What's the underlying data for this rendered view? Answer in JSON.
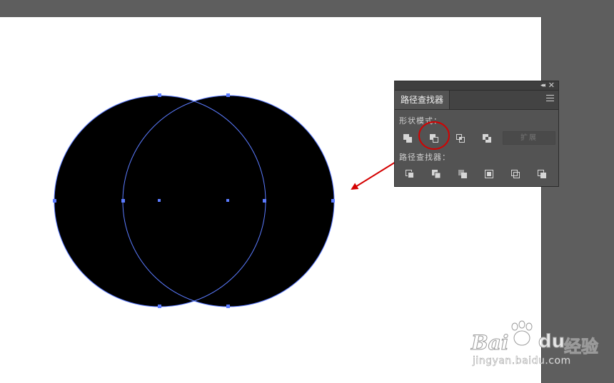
{
  "window": {
    "background": "#5e5e5e",
    "artboard_color": "#ffffff"
  },
  "artwork": {
    "fill_color": "#000000",
    "selection_color": "#5b7bff",
    "annotation_color": "#d40000",
    "shapes": [
      {
        "name": "left-circle",
        "type": "circle"
      },
      {
        "name": "right-circle",
        "type": "circle"
      }
    ]
  },
  "pathfinder_panel": {
    "collapse_glyph": "◂◂",
    "close_glyph": "✕",
    "tab_label": "路径查找器",
    "shape_modes_label": "形状模式：",
    "pathfinders_label": "路径查找器：",
    "expand_label": "扩展",
    "shape_mode_buttons": [
      {
        "icon": "unite-icon",
        "highlighted": false
      },
      {
        "icon": "minus-front-icon",
        "highlighted": true
      },
      {
        "icon": "intersect-icon",
        "highlighted": false
      },
      {
        "icon": "exclude-icon",
        "highlighted": false
      }
    ],
    "pathfinder_buttons": [
      {
        "icon": "divide-icon"
      },
      {
        "icon": "trim-icon"
      },
      {
        "icon": "merge-icon"
      },
      {
        "icon": "crop-icon"
      },
      {
        "icon": "outline-icon"
      },
      {
        "icon": "minus-back-icon"
      }
    ]
  },
  "watermark": {
    "brand_left": "Bai",
    "brand_right": "du",
    "brand_cn": "经验",
    "url": "jingyan.baidu.com"
  }
}
